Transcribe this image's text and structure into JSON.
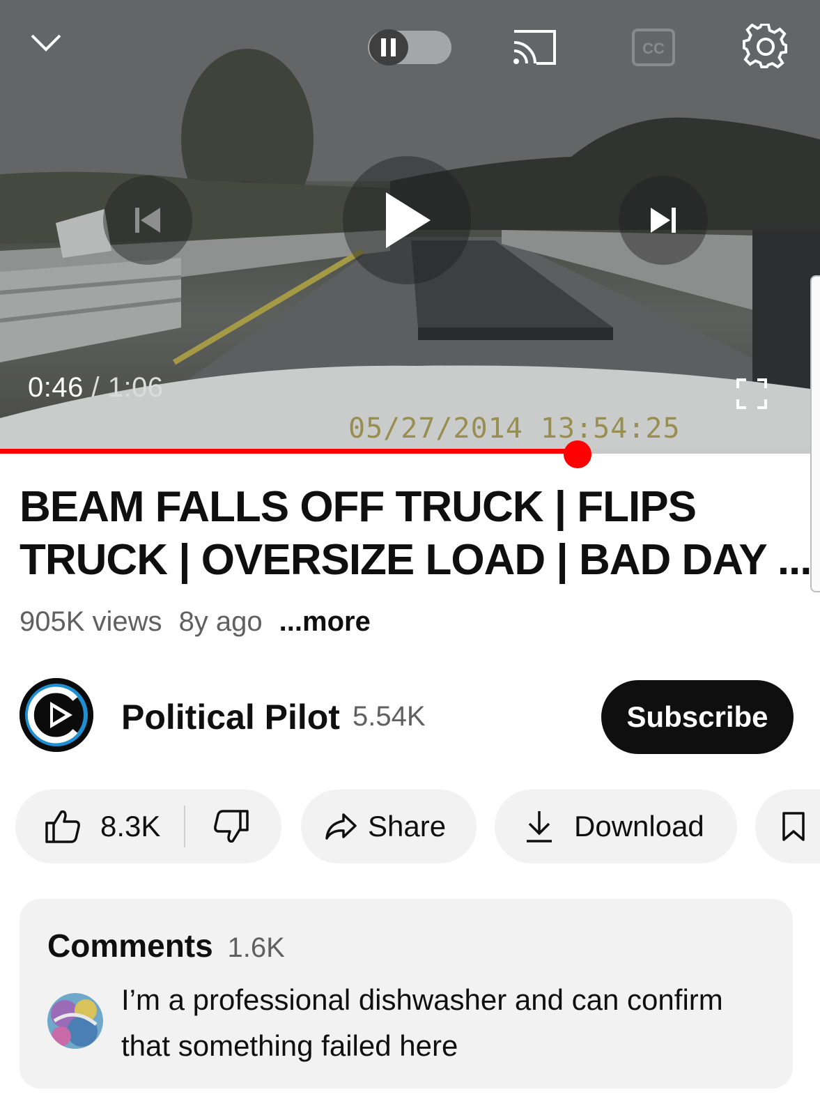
{
  "player": {
    "current_time": "0:46",
    "separator": " / ",
    "duration": "1:06",
    "progress": 0.696,
    "timestamp_overlay": "05/27/2014 13:54:25",
    "icons": [
      "chevron-down-icon",
      "pause-icon",
      "autoplay-toggle",
      "cast-icon",
      "captions-icon",
      "settings-icon",
      "previous-icon",
      "play-icon",
      "next-icon",
      "fullscreen-icon"
    ],
    "captions_label": "CC"
  },
  "video": {
    "title_line1": "BEAM FALLS OFF TRUCK | FLIPS",
    "title_line2": "TRUCK | OVERSIZE LOAD | BAD DAY ...",
    "views": "905K views",
    "age": "8y ago",
    "more": "...more"
  },
  "channel": {
    "name": "Political Pilot",
    "subscribers": "5.54K",
    "subscribe_label": "Subscribe"
  },
  "actions": {
    "likes": "8.3K",
    "share": "Share",
    "download": "Download"
  },
  "comments": {
    "title": "Comments",
    "count": "1.6K",
    "top_comment": "I’m a professional dishwasher and can confirm that something failed here"
  },
  "colors": {
    "progress": "#ff0000",
    "subscribe_bg": "#0f0f0f",
    "pill_bg": "#f2f2f2",
    "secondary_text": "#606060"
  }
}
